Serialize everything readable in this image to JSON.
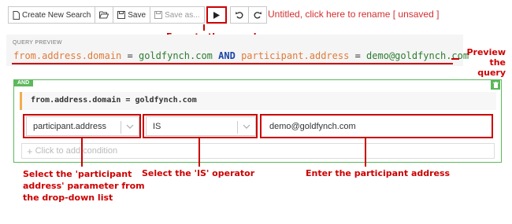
{
  "toolbar": {
    "create_new_search": "Create New Search",
    "open_label": "",
    "save": "Save",
    "save_as": "Save as...",
    "execute_label": "",
    "undo_label": "",
    "redo_label": ""
  },
  "search_title": "Untitled, click here to rename [ unsaved ]",
  "query_preview": {
    "label": "QUERY PREVIEW",
    "field1": "from.address.domain",
    "op1": "=",
    "value1": "goldfynch.com",
    "conjunction": "AND",
    "field2": "participant.address",
    "op2": "=",
    "value2": "demo@goldfynch.com"
  },
  "builder": {
    "group_operator": "AND",
    "existing_condition": "from.address.domain = goldfynch.com",
    "parameter_select": "participant.address",
    "operator_select": "IS",
    "value_input": "demo@goldfynch.com",
    "add_condition_placeholder": "Click to add condition"
  },
  "annotations": {
    "execute": "Execute the search",
    "preview_line1": "Preview",
    "preview_line2": "the query",
    "select_param_line1": "Select the 'participant",
    "select_param_line2": "address' parameter from",
    "select_param_line3": "the drop-down list",
    "select_operator": "Select the 'IS' operator",
    "enter_address": "Enter the participant address"
  },
  "colors": {
    "annotation_red": "#cc0000",
    "title_red": "#d32f2f",
    "group_green": "#5cb85c",
    "field_orange": "#e07b39",
    "value_green": "#2e7d32",
    "keyword_blue": "#1a46a8",
    "condition_accent": "#f0ad4e"
  }
}
